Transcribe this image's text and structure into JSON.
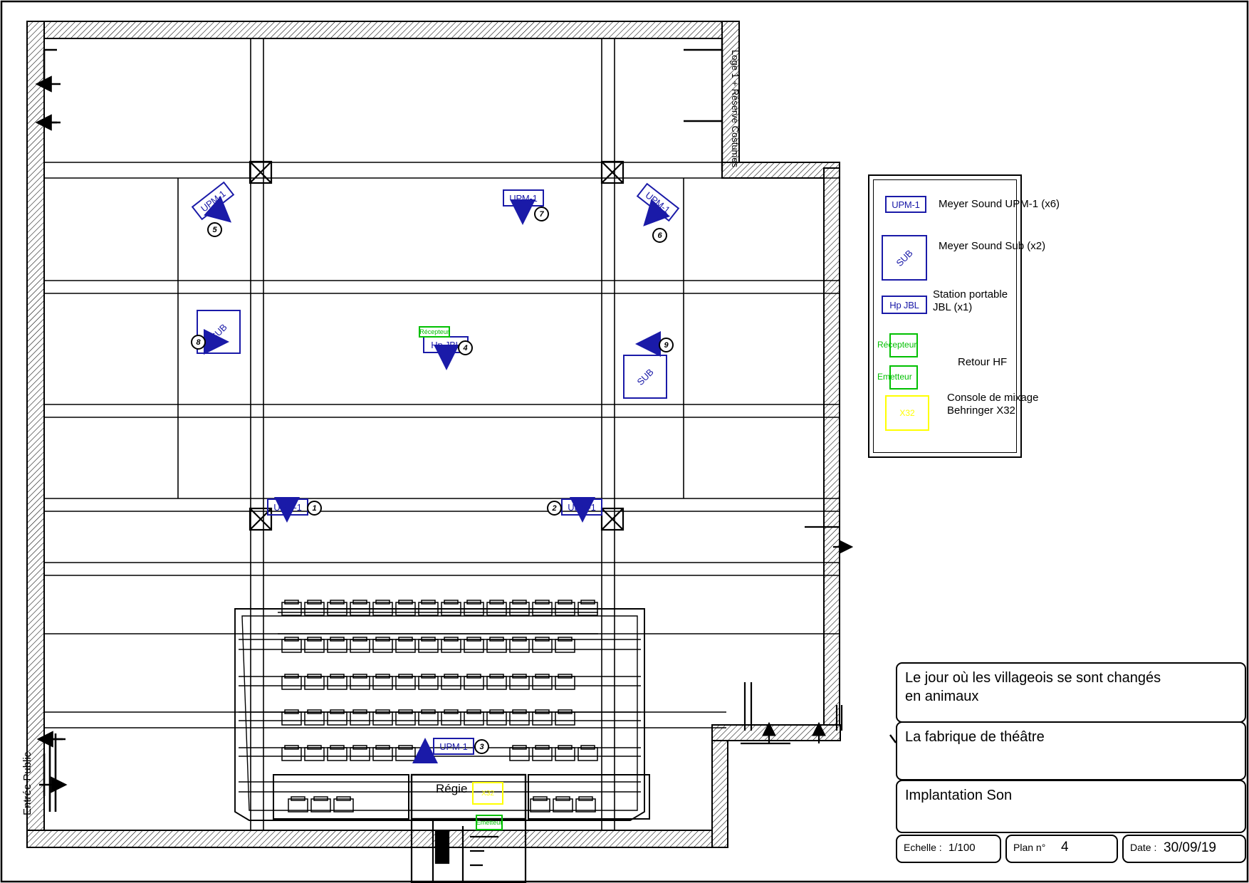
{
  "document": {
    "type": "architectural-floor-plan",
    "discipline": "Implantation Son",
    "entrance_label": "Entrée Public",
    "backstage_label": "Loge 1 + Réserve Costumes",
    "control_booth_label": "Régie"
  },
  "legend": {
    "items": [
      {
        "symbol": "UPM-1",
        "symbol_type": "blue-box",
        "label": "Meyer Sound UPM-1 (x6)"
      },
      {
        "symbol": "SUB",
        "symbol_type": "blue-square",
        "label": "Meyer Sound Sub (x2)"
      },
      {
        "symbol": "Hp JBL",
        "symbol_type": "blue-box",
        "label": "Station portable\nJBL (x1)"
      },
      {
        "symbol": "Récepteur",
        "symbol_type": "green-box",
        "label": ""
      },
      {
        "symbol": "Emetteur",
        "symbol_type": "green-box",
        "label": ""
      },
      {
        "symbol": "",
        "symbol_type": "bracket",
        "label": "Retour HF"
      },
      {
        "symbol": "X32",
        "symbol_type": "yellow-box",
        "label": "Console de mixage\nBehringer X32"
      }
    ]
  },
  "markers": {
    "upm": [
      {
        "id": "upm-left-upper",
        "label": "UPM-1",
        "number": "5"
      },
      {
        "id": "upm-center-upper",
        "label": "UPM-1",
        "number": "7"
      },
      {
        "id": "upm-right-upper",
        "label": "UPM-1",
        "number": "6"
      },
      {
        "id": "upm-left-mid",
        "label": "UPM-1",
        "number": "1"
      },
      {
        "id": "upm-right-mid",
        "label": "UPM-1",
        "number": "2"
      },
      {
        "id": "upm-house",
        "label": "UPM-1",
        "number": "3"
      }
    ],
    "subs": [
      {
        "id": "sub-left",
        "label": "SUB"
      },
      {
        "id": "sub-right",
        "label": "SUB"
      }
    ],
    "jbl": {
      "id": "hp-jbl-center",
      "label": "Hp JBL",
      "number": "4"
    },
    "arrows_only": [
      {
        "id": "arrow-left-mid",
        "number": "8"
      },
      {
        "id": "arrow-right-mid",
        "number": "9"
      }
    ],
    "hf": {
      "receiver_label": "Récepteur",
      "transmitter_label": "Emetteur"
    },
    "console": {
      "id": "console-x32",
      "label": "X32"
    }
  },
  "titleblock": {
    "production_title": "Le jour où les villageois se sont changés\nen animaux",
    "company": "La fabrique de théâtre",
    "drawing_title": "Implantation Son",
    "scale_label": "Echelle : ",
    "scale_value": "1/100",
    "plan_label": "Plan n°",
    "plan_value": "4",
    "date_label": "Date : ",
    "date_value": "30/09/19"
  },
  "colors": {
    "speaker_blue": "#1a1aa8",
    "hf_green": "#00c000",
    "console_yellow": "#ffff00",
    "line_black": "#000000"
  }
}
